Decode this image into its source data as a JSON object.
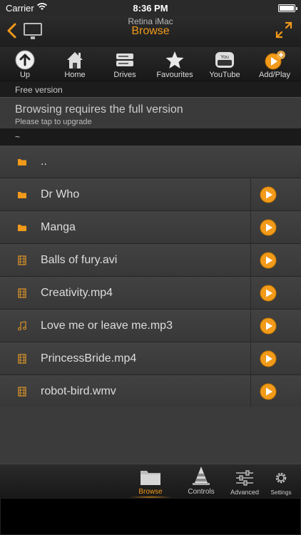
{
  "status": {
    "carrier": "Carrier",
    "time": "8:36 PM",
    "battery_level": 0.9
  },
  "navbar": {
    "subtitle": "Retina iMac",
    "title": "Browse",
    "back_icon": "chevron-left-icon",
    "device_icon": "monitor-icon",
    "expand_icon": "expand-icon"
  },
  "toolbar": [
    {
      "label": "Up",
      "icon": "up-arrow-icon"
    },
    {
      "label": "Home",
      "icon": "home-icon"
    },
    {
      "label": "Drives",
      "icon": "drive-icon"
    },
    {
      "label": "Favourites",
      "icon": "star-icon"
    },
    {
      "label": "YouTube",
      "icon": "youtube-icon"
    },
    {
      "label": "Add/Play",
      "icon": "add-play-icon"
    }
  ],
  "banner": {
    "free_version": "Free version",
    "upgrade_title": "Browsing requires the full version",
    "upgrade_subtitle": "Please tap to upgrade"
  },
  "path": "~",
  "files": [
    {
      "name": "..",
      "type": "folder",
      "playable": false
    },
    {
      "name": "Dr Who",
      "type": "folder",
      "playable": true
    },
    {
      "name": "Manga",
      "type": "folder",
      "playable": true
    },
    {
      "name": "Balls of fury.avi",
      "type": "video",
      "playable": true
    },
    {
      "name": "Creativity.mp4",
      "type": "video",
      "playable": true
    },
    {
      "name": "Love me or leave me.mp3",
      "type": "audio",
      "playable": true
    },
    {
      "name": "PrincessBride.mp4",
      "type": "video",
      "playable": true
    },
    {
      "name": "robot-bird.wmv",
      "type": "video",
      "playable": true
    }
  ],
  "tabs": [
    {
      "label": "Browse",
      "icon": "folder-icon",
      "active": true
    },
    {
      "label": "Controls",
      "icon": "cone-icon",
      "active": false
    },
    {
      "label": "Advanced",
      "icon": "sliders-icon",
      "active": false
    },
    {
      "label": "Settings",
      "icon": "gear-icon",
      "active": false
    }
  ],
  "colors": {
    "accent": "#f29a1a",
    "background": "#3b3b3b"
  }
}
